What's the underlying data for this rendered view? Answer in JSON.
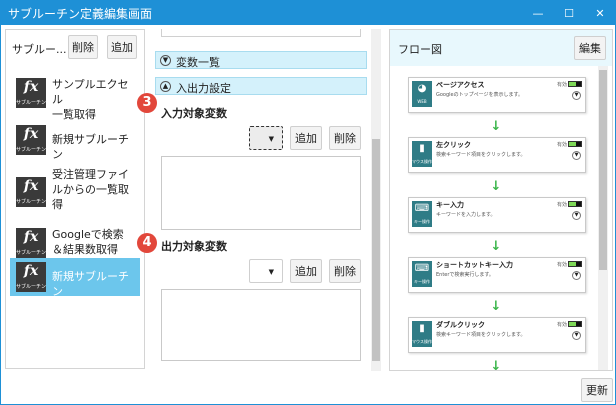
{
  "window": {
    "title": "サブルーチン定義編集画面",
    "controls": [
      "—",
      "☐",
      "✕"
    ]
  },
  "left": {
    "title": "サブルー...",
    "delete_label": "削除",
    "add_label": "追加",
    "icon_text": "fx",
    "icon_caption": "サブルーチン",
    "items": [
      {
        "lines": [
          "サンプルエクセル",
          "一覧取得"
        ],
        "selected": false
      },
      {
        "lines": [
          "新規サブルーチン"
        ],
        "selected": false
      },
      {
        "lines": [
          "受注管理ファイ",
          "ルからの一覧取",
          "得"
        ],
        "selected": false
      },
      {
        "lines": [
          "Googleで検索",
          "＆結果数取得"
        ],
        "selected": false
      },
      {
        "lines": [
          "新規サブルーチン"
        ],
        "selected": true
      }
    ]
  },
  "middle": {
    "section_vars": "変数一覧",
    "section_io": "入出力設定",
    "input": {
      "badge": "3",
      "label": "入力対象変数",
      "add_label": "追加",
      "delete_label": "削除"
    },
    "output": {
      "badge": "4",
      "label": "出力対象変数",
      "add_label": "追加",
      "delete_label": "削除"
    }
  },
  "right": {
    "title": "フロー図",
    "edit_label": "編集",
    "enabled_label": "有効",
    "cards": [
      {
        "title": "ページアクセス",
        "desc": "Googleのトップページを表示します。",
        "icon": "browser-icon",
        "glyph": "◕",
        "caption": "WEB"
      },
      {
        "title": "左クリック",
        "desc": "検索キーワード項目をクリックします。",
        "icon": "mouse-icon",
        "glyph": "▮",
        "caption": "マウス操作"
      },
      {
        "title": "キー入力",
        "desc": "キーワードを入力します。",
        "icon": "keyboard-icon",
        "glyph": "⌨",
        "caption": "キー操作"
      },
      {
        "title": "ショートカットキー入力",
        "desc": "Enterで検索実行します。",
        "icon": "keyboard-icon",
        "glyph": "⌨",
        "caption": "キー操作"
      },
      {
        "title": "ダブルクリック",
        "desc": "検索キーワード項目をクリックします。",
        "icon": "mouse-icon",
        "glyph": "▮",
        "caption": "マウス操作"
      }
    ]
  },
  "footer": {
    "update_label": "更新"
  },
  "colors": {
    "accent": "#1e90d6",
    "selected": "#6cc6ec",
    "badge": "#e2473b",
    "arrow": "#3ab54a",
    "section_bg": "#d4f1fb"
  }
}
